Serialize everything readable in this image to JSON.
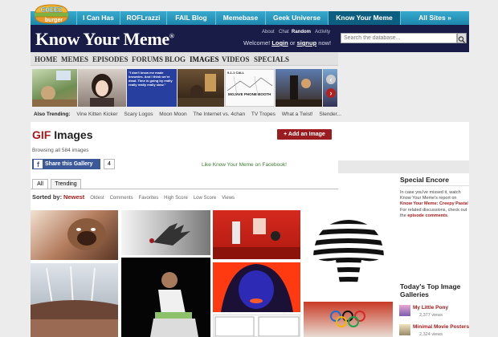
{
  "cheez": {
    "logo_top": "CHEEZ",
    "logo_bottom": "burger",
    "tabs": [
      "I Can Has",
      "ROFLrazzi",
      "FAIL Blog",
      "Memebase",
      "Geek Universe",
      "Know Your Meme",
      "All Sites »"
    ]
  },
  "header": {
    "title": "Know Your Meme",
    "reg": "®",
    "links": [
      "About",
      "Chat",
      "Random",
      "Activity"
    ],
    "welcome_prefix": "Welcome!",
    "login": "Login",
    "or": "or",
    "signup": "signup",
    "now": "now!",
    "search_placeholder": "Search the database..."
  },
  "nav": [
    "HOME",
    "MEMES",
    "EPISODES",
    "FORUMS",
    "BLOG",
    "IMAGES",
    "VIDEOS",
    "SPECIALS"
  ],
  "strip": {
    "quote": "\"I don't know me made brownies. And I think we're dead. Time is going by really really really really slow.\"",
    "call": "9-1-1 CALL",
    "phone": "MOJAVE PHONE BOOTH"
  },
  "trending": {
    "label": "Also Trending:",
    "items": [
      "Vine Kitten Kicker",
      "Scary Logos",
      "Moon Moon",
      "The Internet vs. 4chan",
      "TV Tropes",
      "What a Twist!",
      "Slender..."
    ]
  },
  "page": {
    "title_red": "GIF",
    "title_rest": " Images",
    "add_button": "+ Add an Image",
    "browsing": "Browsing all 584 images",
    "share_button": "Share this Gallery",
    "share_count": "4",
    "fb_like": "Like Know Your Meme on Facebook!",
    "tabs": [
      "All",
      "Trending"
    ],
    "sort_label": "Sorted by:",
    "sort_active": "Newest",
    "sort_options": [
      "Oldest",
      "Comments",
      "Favorites",
      "High Score",
      "Low Score",
      "Views"
    ]
  },
  "sidebar": {
    "encore_title": "Special Encore",
    "encore_text_1": "In case you've missed it, watch Know Your Meme's report on",
    "encore_link": "Know Your Meme: Creepy Pasta",
    "encore_text_2": "! For related discussions, check out the",
    "encore_link2": "episode comments",
    "encore_end": ".",
    "galleries_title": "Today's Top Image Galleries",
    "galleries": [
      {
        "name": "My Little Pony",
        "views": "2,377 views"
      },
      {
        "name": "Minimal Movie Posters",
        "views": "2,324 views"
      }
    ]
  },
  "colors": {
    "accent": "#a51a1a",
    "header": "#191c47",
    "cheez": "#1d86ad",
    "facebook": "#3b5998"
  }
}
